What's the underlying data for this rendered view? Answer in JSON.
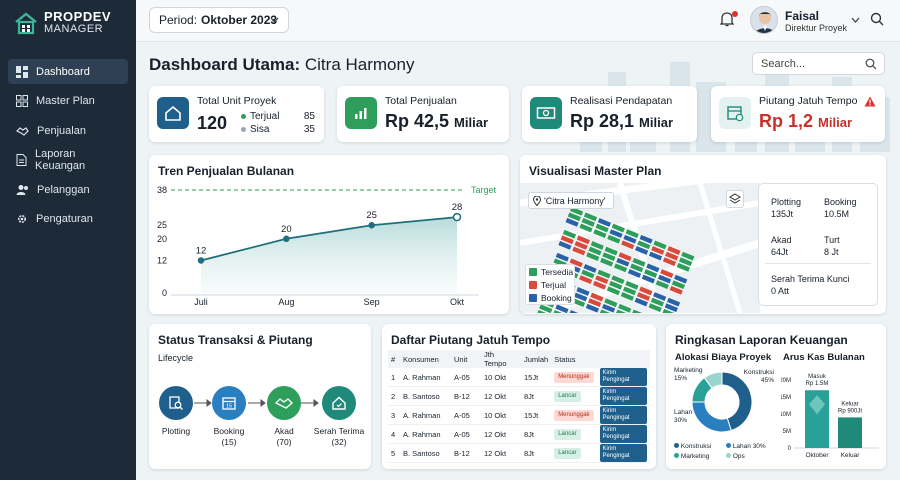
{
  "sidebar": {
    "logo_line1": "PROPDEV",
    "logo_line2": "MANAGER",
    "items": [
      {
        "label": "Dashboard",
        "icon": "dashboard-icon"
      },
      {
        "label": "Master Plan",
        "icon": "grid-icon"
      },
      {
        "label": "Penjualan",
        "icon": "handshake-icon"
      },
      {
        "label": "Laporan Keuangan",
        "icon": "document-icon"
      },
      {
        "label": "Pelanggan",
        "icon": "users-icon"
      },
      {
        "label": "Pengaturan",
        "icon": "gear-icon"
      }
    ]
  },
  "topbar": {
    "period_label": "Period:",
    "period_value": "Oktober 2023",
    "user_name": "Faisal",
    "user_role": "Direktur Proyek"
  },
  "page": {
    "title_bold": "Dashboard Utama:",
    "title_rest": "Citra Harmony",
    "search_placeholder": "Search..."
  },
  "kpi": {
    "unit": {
      "title": "Total Unit Proyek",
      "value": "120",
      "sold_label": "Terjual",
      "sold_value": "85",
      "rest_label": "Sisa",
      "rest_value": "35"
    },
    "sales": {
      "title": "Total Penjualan",
      "value": "Rp 42,5",
      "unit": "Miliar"
    },
    "revenue": {
      "title": "Realisasi Pendapatan",
      "value": "Rp 28,1",
      "unit": "Miliar"
    },
    "receivable": {
      "title": "Piutang Jatuh Tempo",
      "value": "Rp 1,2",
      "unit": "Miliar"
    }
  },
  "trend": {
    "title": "Tren Penjualan Bulanan",
    "target_label": "Target"
  },
  "chart_data": {
    "type": "area",
    "title": "Tren Penjualan Bulanan",
    "categories": [
      "Juli",
      "Aug",
      "Sep",
      "Okt"
    ],
    "values": [
      12,
      20,
      25,
      28
    ],
    "yticks": [
      0,
      12,
      20,
      25,
      38
    ],
    "ylim": [
      0,
      38
    ],
    "target": 38,
    "target_label": "Target",
    "grid": false
  },
  "masterplan": {
    "title": "Visualisasi Master Plan",
    "location": "'Citra Harmony'",
    "legend": [
      {
        "label": "Tersedia",
        "color": "#2e9e5b"
      },
      {
        "label": "Terjual",
        "color": "#d84a3c"
      },
      {
        "label": "Booking",
        "color": "#2a62a8"
      }
    ],
    "info": {
      "plotting_label": "Plotting",
      "plotting_value": "135Jt",
      "booking_label": "Booking",
      "booking_value": "10.5M",
      "akad_label": "Akad",
      "akad_value": "64Jt",
      "turt_label": "Turt",
      "turt_value": "8 Jt",
      "serah_label": "Serah Terima Kunci",
      "serah_value": "0 Att"
    }
  },
  "status": {
    "title": "Status Transaksi & Piutang",
    "subtitle": "Lifecycle",
    "steps": [
      {
        "label": "Plotting",
        "count": "",
        "color": "#1f5f8b",
        "icon": "plot-search-icon"
      },
      {
        "label": "Booking",
        "count": "(15)",
        "color": "#2a7fc1",
        "icon": "calendar-icon"
      },
      {
        "label": "Akad",
        "count": "(70)",
        "color": "#2e9e5b",
        "icon": "handshake-icon"
      },
      {
        "label": "Serah Terima",
        "count": "(32)",
        "color": "#1f8a7a",
        "icon": "house-icon"
      }
    ]
  },
  "receivables": {
    "title": "Daftar Piutang Jatuh Tempo",
    "headers": [
      "#",
      "Konsumen",
      "Unit",
      "Jth Tempo",
      "Jumlah",
      "Status"
    ],
    "rows": [
      {
        "no": "1",
        "name": "A. Rahman",
        "unit": "A-05",
        "due": "10 Okt",
        "amount": "15Jt",
        "status": "Menunggak",
        "action": "Kirim Pengingat"
      },
      {
        "no": "2",
        "name": "B. Santoso",
        "unit": "B-12",
        "due": "12 Okt",
        "amount": "8Jt",
        "status": "Lancar",
        "action": "Kirim Pengingat"
      },
      {
        "no": "3",
        "name": "A. Rahman",
        "unit": "A-05",
        "due": "10 Okt",
        "amount": "15Jt",
        "status": "Menunggak",
        "action": "Kirim Pengingat"
      },
      {
        "no": "4",
        "name": "A. Rahman",
        "unit": "A-05",
        "due": "12 Okt",
        "amount": "8Jt",
        "status": "Lancar",
        "action": "Kirim Pengingat"
      },
      {
        "no": "5",
        "name": "B. Santoso",
        "unit": "B-12",
        "due": "12 Okt",
        "amount": "8Jt",
        "status": "Lancar",
        "action": "Kirim Pengingat"
      }
    ]
  },
  "finance": {
    "title": "Ringkasan Laporan Keuangan",
    "cost_title": "Alokasi Biaya Proyek",
    "donut": [
      {
        "label": "Konstruksi",
        "value": 45,
        "pct": "45%",
        "color": "#1f5f8b"
      },
      {
        "label": "Lahan",
        "value": 30,
        "pct": "30%",
        "color": "#2a7fc1"
      },
      {
        "label": "Marketing",
        "value": 15,
        "pct": "15%",
        "color": "#2aa198"
      },
      {
        "label": "Ops",
        "value": 10,
        "pct": "",
        "color": "#9ad4cf"
      }
    ],
    "legend": [
      "Konstruksi",
      "Lahan 30%",
      "Marketing",
      "Ops"
    ],
    "cash_title": "Arus Kas Bulanan",
    "cash_yticks": [
      "20M",
      "15M",
      "10M",
      "5M",
      "0"
    ],
    "cash_bars": [
      {
        "label": "Oktober",
        "value": 17,
        "note": "Masuk",
        "note2": "Rp 1.5M",
        "color": "#2aa198"
      },
      {
        "label": "Keluar",
        "value": 9,
        "note": "Keluar",
        "note2": "Rp 900Jt",
        "color": "#1f8a7a"
      }
    ],
    "cash_ymax": 20
  }
}
